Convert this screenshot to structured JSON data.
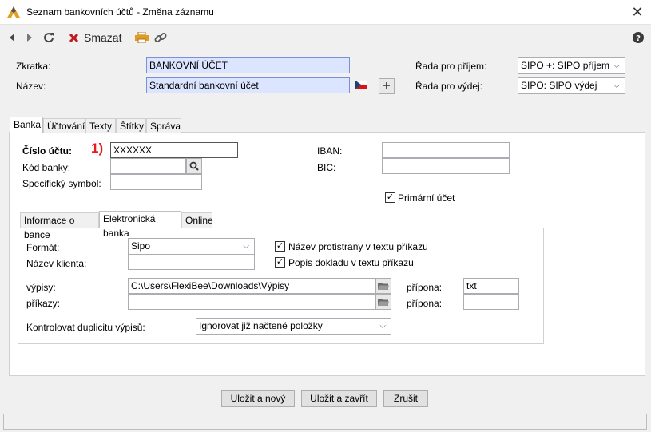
{
  "window": {
    "title": "Seznam bankovních účtů - Změna záznamu",
    "close_glyph": "✕"
  },
  "toolbar": {
    "delete_label": "Smazat",
    "icons": [
      "back-arrow-icon",
      "forward-arrow-icon",
      "refresh-icon",
      "delete-x-icon",
      "printer-icon",
      "link-icon",
      "help-icon"
    ]
  },
  "header": {
    "zkratka_label": "Zkratka:",
    "zkratka_value": "BANKOVNÍ ÚČET",
    "nazev_label": "Název:",
    "nazev_value": "Standardní bankovní účet",
    "rada_prijem_label": "Řada pro příjem:",
    "rada_prijem_value": "SIPO +: SIPO příjem",
    "rada_vydej_label": "Řada pro výdej:",
    "rada_vydej_value": "SIPO: SIPO výdej",
    "plus_glyph": "+"
  },
  "tabs": [
    {
      "label": "Banka",
      "active": true
    },
    {
      "label": "Účtování",
      "active": false
    },
    {
      "label": "Texty",
      "active": false
    },
    {
      "label": "Štítky",
      "active": false
    },
    {
      "label": "Správa",
      "active": false
    }
  ],
  "banka": {
    "cislo_uctu_label": "Číslo účtu:",
    "cislo_uctu_value": "XXXXXX",
    "annotation": "1)",
    "kod_banky_label": "Kód banky:",
    "kod_banky_value": "",
    "spec_symbol_label": "Specifický symbol:",
    "spec_symbol_value": "",
    "iban_label": "IBAN:",
    "iban_value": "",
    "bic_label": "BIC:",
    "bic_value": "",
    "primarni_label": "Primární účet",
    "primarni_checked": true
  },
  "subtabs": [
    {
      "label": "Informace o bance",
      "active": false
    },
    {
      "label": "Elektronická banka",
      "active": true
    },
    {
      "label": "Online",
      "active": false
    }
  ],
  "ebanka": {
    "format_label": "Formát:",
    "format_value": "Sipo",
    "nazev_klienta_label": "Název klienta:",
    "nazev_klienta_value": "",
    "nazev_protistrany_label": "Název protistrany v textu příkazu",
    "nazev_protistrany_checked": true,
    "popis_dokladu_label": "Popis dokladu v textu příkazu",
    "popis_dokladu_checked": true,
    "vypisy_label": "výpisy:",
    "vypisy_value": "C:\\Users\\FlexiBee\\Downloads\\Výpisy",
    "vypisy_pripona_label": "přípona:",
    "vypisy_pripona_value": "txt",
    "prikazy_label": "příkazy:",
    "prikazy_value": "",
    "prikazy_pripona_label": "přípona:",
    "prikazy_pripona_value": "",
    "duplicity_label": "Kontrolovat duplicitu výpisů:",
    "duplicity_value": "Ignorovat již načtené položky"
  },
  "footer": {
    "save_new": "Uložit a nový",
    "save_close": "Uložit a zavřít",
    "cancel": "Zrušit"
  },
  "colors": {
    "accent_red": "#c0191f",
    "annotation_red": "#e8191f",
    "field_blue": "#dbe5ff",
    "printer_orange": "#e09b22"
  }
}
